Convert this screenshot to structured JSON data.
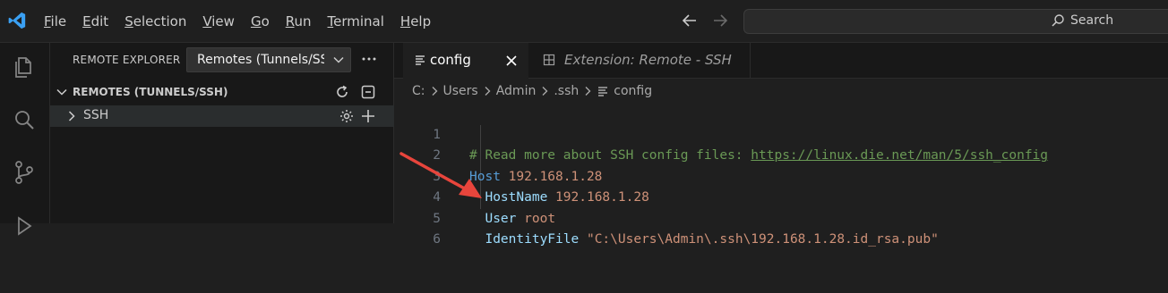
{
  "menu": [
    "File",
    "Edit",
    "Selection",
    "View",
    "Go",
    "Run",
    "Terminal",
    "Help"
  ],
  "menu_underline": [
    "F",
    "E",
    "S",
    "V",
    "G",
    "R",
    "T",
    "H"
  ],
  "search": {
    "label": "Search"
  },
  "sidebar": {
    "title": "REMOTE EXPLORER",
    "select_value": "Remotes (Tunnels/SSH)",
    "section_title": "REMOTES (TUNNELS/SSH)",
    "tree_item": "SSH"
  },
  "tabs": [
    {
      "label": "config",
      "active": true
    },
    {
      "label": "Extension: Remote - SSH",
      "active": false
    }
  ],
  "breadcrumb": [
    "C:",
    "Users",
    "Admin",
    ".ssh",
    "config"
  ],
  "code_lines": [
    {
      "num": "1",
      "comment": "# Read more about SSH config files: ",
      "link": "https://linux.die.net/man/5/ssh_config"
    },
    {
      "num": "2",
      "key": "Host",
      "value": "192.168.1.28"
    },
    {
      "num": "3",
      "key": "HostName",
      "value": "192.168.1.28"
    },
    {
      "num": "4",
      "key": "User",
      "value": "root"
    },
    {
      "num": "5",
      "key": "IdentityFile",
      "value": "\"C:\\Users\\Admin\\.ssh\\192.168.1.28.id_rsa.pub\""
    },
    {
      "num": "6"
    }
  ],
  "colors": {
    "accent": "#0078d4",
    "arrow": "#e8453c",
    "comment": "#6a9955",
    "keyword": "#569cd6",
    "string": "#ce9178"
  }
}
